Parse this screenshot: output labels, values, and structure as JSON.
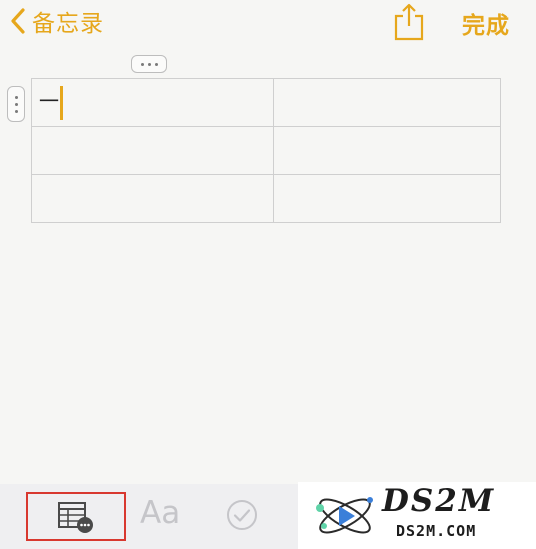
{
  "nav": {
    "back_label": "备忘录",
    "done_label": "完成",
    "accent_color": "#e6a71c",
    "icons": [
      "chevron-left-icon",
      "share-icon"
    ]
  },
  "table": {
    "rows": [
      [
        "一",
        ""
      ],
      [
        "",
        ""
      ],
      [
        "",
        ""
      ]
    ]
  },
  "toolbar": {
    "format_label": "Aa",
    "icons": [
      "table-options-icon",
      "checklist-icon"
    ],
    "highlight_color": "#d8382f"
  },
  "watermark": {
    "title": "DS2M",
    "subtitle": "DS2M.COM"
  }
}
